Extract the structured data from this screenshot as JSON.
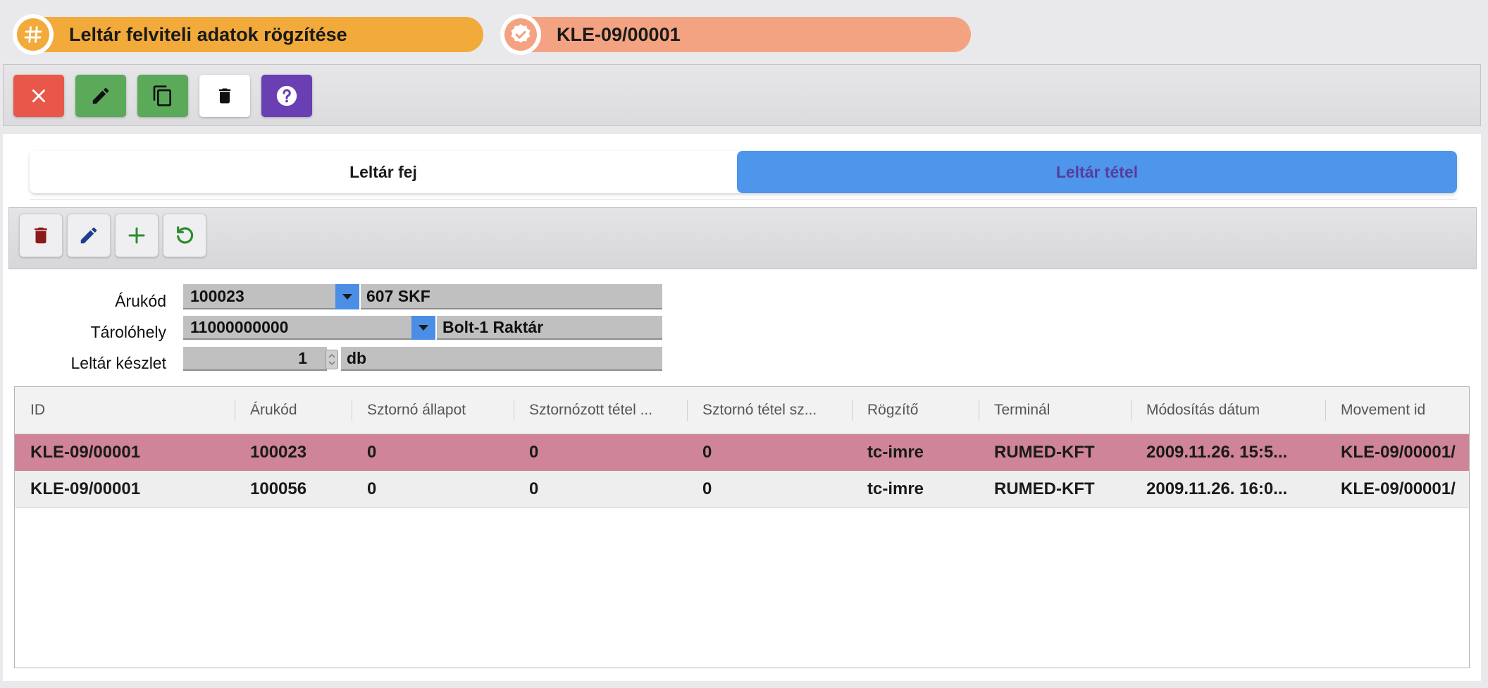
{
  "header": {
    "form_title": "Leltár felviteli adatok rögzítése",
    "record_id": "KLE-09/00001",
    "form_icon": "hash-icon",
    "record_icon": "verified-badge-icon",
    "colors": {
      "title_pill": "#f2aa3a",
      "record_pill": "#f4a382"
    }
  },
  "toolbar": {
    "buttons": [
      {
        "name": "close",
        "icon": "close-icon",
        "color": "#e8574a"
      },
      {
        "name": "edit",
        "icon": "pencil-icon",
        "color": "#5aaa5a"
      },
      {
        "name": "copy",
        "icon": "copy-icon",
        "color": "#5aaa5a"
      },
      {
        "name": "delete",
        "icon": "trash-icon",
        "color": "#ffffff"
      },
      {
        "name": "help",
        "icon": "help-icon",
        "color": "#6a3fb3"
      }
    ]
  },
  "tabs": [
    {
      "label": "Leltár fej",
      "active": false
    },
    {
      "label": "Leltár tétel",
      "active": true
    }
  ],
  "sub_toolbar": {
    "buttons": [
      {
        "name": "delete",
        "icon": "trash-icon",
        "color": "#8b1a1a"
      },
      {
        "name": "edit",
        "icon": "pencil-icon",
        "color": "#1d3f8c"
      },
      {
        "name": "add",
        "icon": "plus-icon",
        "color": "#2e8b2e"
      },
      {
        "name": "refresh",
        "icon": "refresh-icon",
        "color": "#2e8b2e"
      }
    ]
  },
  "form": {
    "arukod": {
      "label": "Árukód",
      "code": "100023",
      "description": "607 SKF"
    },
    "tarolohely": {
      "label": "Tárolóhely",
      "code": "11000000000",
      "description": "Bolt-1 Raktár"
    },
    "keszlet": {
      "label": "Leltár készlet",
      "value": "1",
      "unit": "db"
    }
  },
  "grid": {
    "columns": [
      "ID",
      "Árukód",
      "Sztornó állapot",
      "Sztornózott tétel ...",
      "Sztornó tétel sz...",
      "Rögzítő",
      "Terminál",
      "Módosítás dátum",
      "Movement id"
    ],
    "rows": [
      {
        "selected": true,
        "cells": [
          "KLE-09/00001",
          "100023",
          "0",
          "0",
          "0",
          "tc-imre",
          "RUMED-KFT",
          "2009.11.26. 15:5...",
          "KLE-09/00001/"
        ]
      },
      {
        "selected": false,
        "cells": [
          "KLE-09/00001",
          "100056",
          "0",
          "0",
          "0",
          "tc-imre",
          "RUMED-KFT",
          "2009.11.26. 16:0...",
          "KLE-09/00001/"
        ]
      }
    ],
    "colors": {
      "selected_row": "#cf8597",
      "row": "#eeeeef"
    }
  }
}
